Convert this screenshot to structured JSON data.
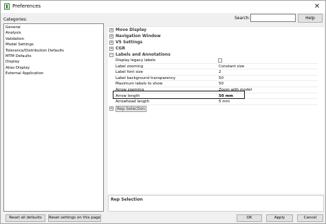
{
  "window": {
    "title": "Preferences"
  },
  "search": {
    "label": "Search:",
    "value": "",
    "help_label": "Help"
  },
  "categories": {
    "label": "Categories:",
    "items": [
      "General",
      "Analysis",
      "Validation",
      "Model Settings",
      "Tolerance/Distribution Defaults",
      "MTM Defaults",
      "Display",
      "Alias Display",
      "External Application"
    ]
  },
  "tree": {
    "groups": [
      {
        "label": "Move Display",
        "expander": "+"
      },
      {
        "label": "Navigation Window",
        "expander": "+"
      },
      {
        "label": "V5 Settings",
        "expander": "+"
      },
      {
        "label": "CGR",
        "expander": "+"
      },
      {
        "label": "Labels and Annotations",
        "expander": "−"
      }
    ],
    "properties": [
      {
        "name": "Display legacy labels",
        "value": ""
      },
      {
        "name": "Label zooming",
        "value": "Constant size"
      },
      {
        "name": "Label font size",
        "value": "2"
      },
      {
        "name": "Label background transparency",
        "value": "50"
      },
      {
        "name": "Maximum labels to show",
        "value": "50"
      },
      {
        "name": "Arrow zooming",
        "value": "Zoom with model"
      },
      {
        "name": "Arrow length",
        "value": "50 mm"
      },
      {
        "name": "Arrowhead length",
        "value": "5 mm"
      }
    ],
    "rep_group": {
      "label": "Rep Selection",
      "expander": "+"
    }
  },
  "description": {
    "title": "Rep Selection"
  },
  "buttons": {
    "reset_all": "Reset all defaults",
    "reset_page": "Reset settings on this page",
    "ok": "OK",
    "apply": "Apply",
    "cancel": "Cancel"
  }
}
